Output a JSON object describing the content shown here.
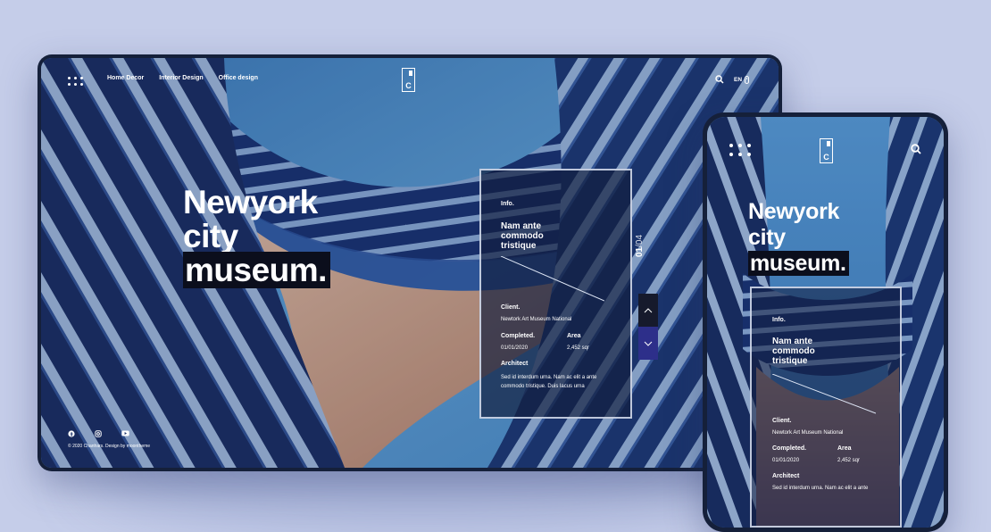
{
  "desktop": {
    "nav": {
      "links": [
        "Home Decor",
        "Interior Design",
        "Office design"
      ],
      "logo_letter": "C",
      "lang": "EN",
      "icons": [
        "menu-grid-icon",
        "search-icon",
        "mouse-scroll-icon"
      ]
    },
    "hero": {
      "line1": "Newyork",
      "line2": "city",
      "line3": "museum."
    },
    "card": {
      "tag": "Info.",
      "title_l1": "Nam ante",
      "title_l2": "commodo",
      "title_l3": "tristique",
      "client_label": "Client.",
      "client_value": "Newtork Art Museum National",
      "completed_label": "Completed.",
      "completed_value": "01/01/2020",
      "area_label": "Area",
      "area_value": "2,452 sqr",
      "architect_label": "Architect",
      "architect_l1": "Sed id interdum urna. Nam ac elit a ante",
      "architect_l2": "commodo tristique. Duis lacus urna"
    },
    "slider": {
      "current": "01",
      "total": "/04",
      "icons": [
        "chevron-up-icon",
        "chevron-down-icon"
      ]
    },
    "footer": {
      "social_icons": [
        "facebook-icon",
        "instagram-icon",
        "youtube-icon"
      ],
      "copyright": "© 2020 Chanhars. Design by moontheme"
    }
  },
  "mobile": {
    "nav": {
      "logo_letter": "C",
      "icons": [
        "menu-grid-icon",
        "search-icon"
      ]
    },
    "hero": {
      "line1": "Newyork",
      "line2": "city",
      "line3": "museum."
    },
    "card": {
      "tag": "Info.",
      "title_l1": "Nam ante",
      "title_l2": "commodo",
      "title_l3": "tristique",
      "client_label": "Client.",
      "client_value": "Newtork Art Museum National",
      "completed_label": "Completed.",
      "completed_value": "01/01/2020",
      "area_label": "Area",
      "area_value": "2,452 sqr",
      "architect_label": "Architect",
      "architect_l1": "Sed id interdum urna. Nam ac elit a ante"
    }
  },
  "colors": {
    "background": "#c5cde9",
    "sky": "#4d8fcc",
    "stripe_dark": "#1d336c",
    "stripe_light": "#a9c3e6",
    "sand": "#d2a68f",
    "accent_button": "#2d2f8a",
    "dark_button": "#161a2c",
    "highlight": "#0b0e1c"
  }
}
